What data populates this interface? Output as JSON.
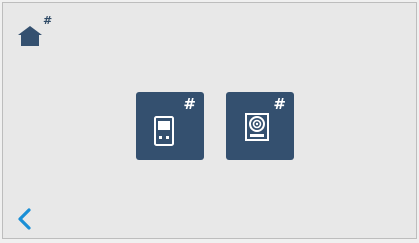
{
  "home": {
    "icon": "home-icon",
    "badge": "#"
  },
  "tiles": [
    {
      "icon": "intercom-handset-icon",
      "badge": "#"
    },
    {
      "icon": "door-station-camera-icon",
      "badge": "#"
    }
  ],
  "nav": {
    "back_icon": "chevron-left-icon"
  },
  "colors": {
    "accent": "#34506f",
    "back_arrow": "#1a8fd6",
    "background": "#e8e8e8"
  }
}
